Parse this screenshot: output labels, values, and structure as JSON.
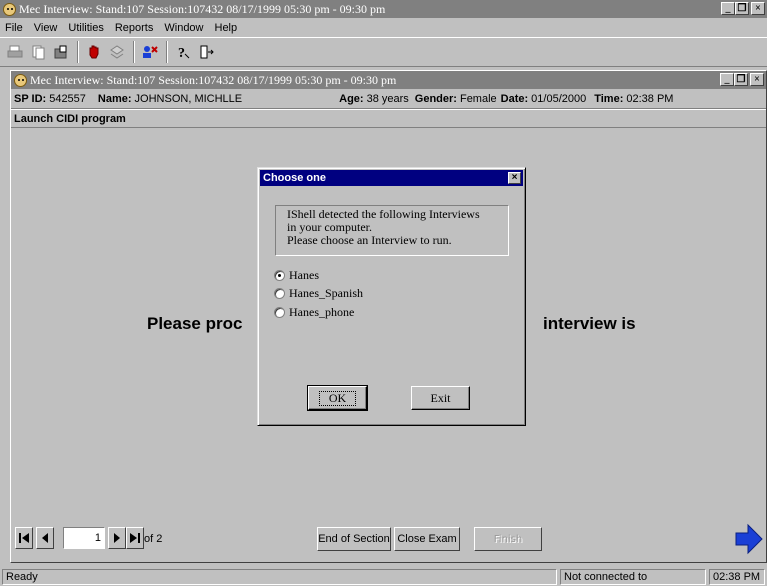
{
  "app": {
    "title": "Mec Interview: Stand:107 Session:107432 08/17/1999 05:30 pm - 09:30 pm",
    "min_glyph": "_",
    "restore_glyph": "❐",
    "close_glyph": "×"
  },
  "menu": [
    "File",
    "View",
    "Utilities",
    "Reports",
    "Window",
    "Help"
  ],
  "toolbar": {
    "buttons": [
      "print-icon",
      "copy-icon",
      "open-icon",
      "stop-hand-icon",
      "tools-icon",
      "person-card-icon",
      "help-icon",
      "exit-door-icon"
    ]
  },
  "inner": {
    "title": "Mec Interview: Stand:107 Session:107432 08/17/1999 05:30 pm - 09:30 pm",
    "sp_id_label": "SP ID:",
    "sp_id": "542557",
    "name_label": "Name:",
    "name": "JOHNSON, MICHLLE",
    "age_label": "Age:",
    "age": "38 years",
    "gender_label": "Gender:",
    "gender": "Female",
    "date_label": "Date:",
    "date": "01/05/2000",
    "time_label": "Time:",
    "time": "02:38 PM",
    "section": "Launch CIDI program",
    "partial_text_left": "Please proc",
    "partial_text_right": "interview is"
  },
  "nav": {
    "page": "1",
    "of_text": "of 2",
    "end_section": "End of Section",
    "close_exam": "Close Exam",
    "finish": "Finish"
  },
  "dialog": {
    "title": "Choose one",
    "message_lines": [
      "IShell detected the following Interviews",
      "in your computer.",
      "Please choose an Interview to run."
    ],
    "options": [
      {
        "label": "Hanes",
        "checked": true
      },
      {
        "label": "Hanes_Spanish",
        "checked": false
      },
      {
        "label": "Hanes_phone",
        "checked": false
      }
    ],
    "ok": "OK",
    "exit": "Exit"
  },
  "status": {
    "left": "Ready",
    "coordinator": "Not connected to Coordinator",
    "clock": "02:38 PM"
  },
  "colors": {
    "dialog_title_bg": "#000080",
    "window_title_inactive": "#808080",
    "next_arrow": "#1a3fd6"
  }
}
